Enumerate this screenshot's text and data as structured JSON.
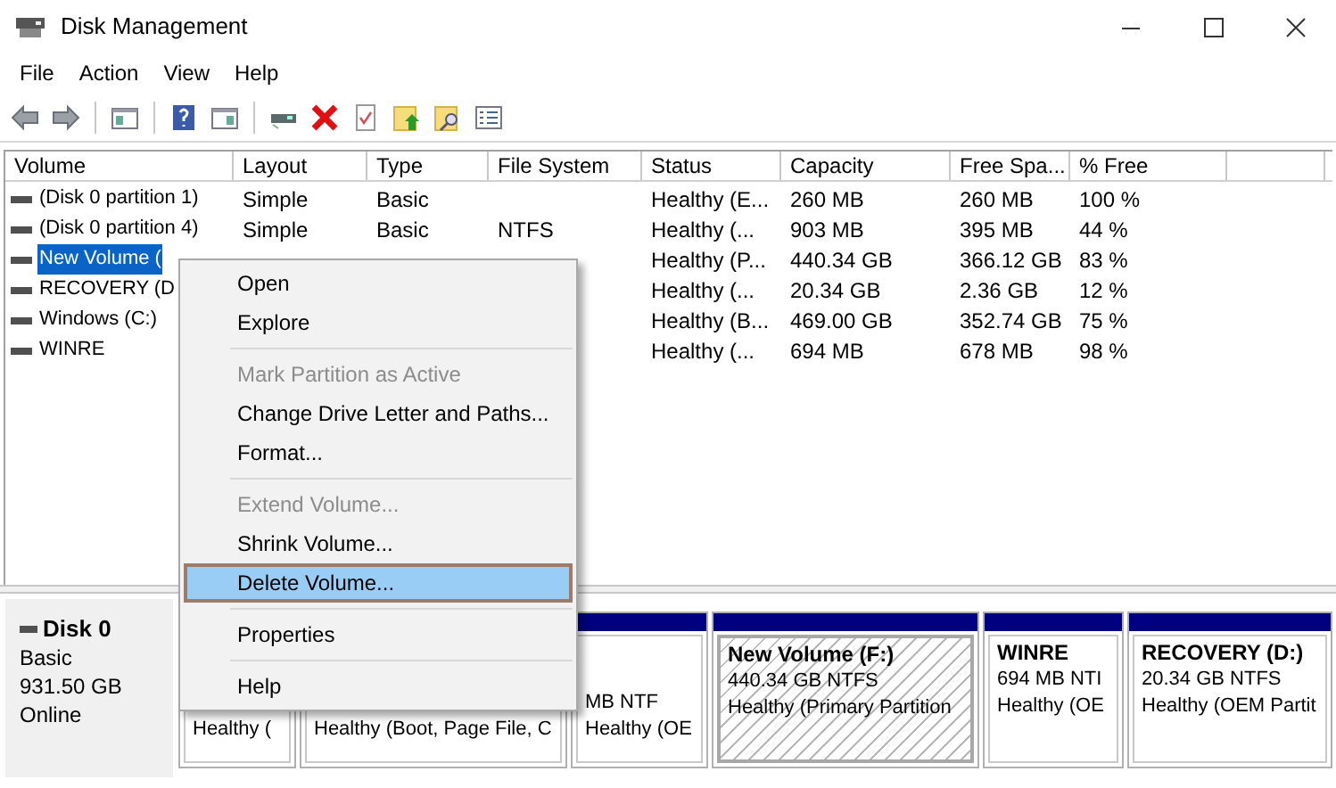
{
  "window": {
    "title": "Disk Management"
  },
  "menu": [
    "File",
    "Action",
    "View",
    "Help"
  ],
  "toolbar": [
    {
      "kind": "back"
    },
    {
      "kind": "forward"
    },
    {
      "kind": "sep"
    },
    {
      "kind": "tree"
    },
    {
      "kind": "sep"
    },
    {
      "kind": "help"
    },
    {
      "kind": "pane"
    },
    {
      "kind": "sep"
    },
    {
      "kind": "connect"
    },
    {
      "kind": "delete"
    },
    {
      "kind": "check"
    },
    {
      "kind": "folder_up"
    },
    {
      "kind": "folder_search"
    },
    {
      "kind": "list"
    }
  ],
  "table": {
    "columns": [
      "Volume",
      "Layout",
      "Type",
      "File System",
      "Status",
      "Capacity",
      "Free Spa...",
      "% Free"
    ],
    "rows": [
      {
        "volume": "(Disk 0 partition 1)",
        "layout": "Simple",
        "type": "Basic",
        "status": "Healthy (E...",
        "capacity": "260 MB",
        "free_space": "260 MB",
        "percent_free": "100 %",
        "selected": false
      },
      {
        "volume": "(Disk 0 partition 4)",
        "layout": "Simple",
        "type": "Basic",
        "file_system": "NTFS",
        "status": "Healthy (...",
        "capacity": "903 MB",
        "free_space": "395 MB",
        "percent_free": "44 %",
        "selected": false
      },
      {
        "volume": "New Volume (",
        "status": "Healthy (P...",
        "capacity": "440.34 GB",
        "free_space": "366.12 GB",
        "percent_free": "83 %",
        "selected": true
      },
      {
        "volume": "RECOVERY (D",
        "status": "Healthy (...",
        "capacity": "20.34 GB",
        "free_space": "2.36 GB",
        "percent_free": "12 %",
        "selected": false
      },
      {
        "volume": "Windows (C:)",
        "status": "Healthy (B...",
        "capacity": "469.00 GB",
        "free_space": "352.74 GB",
        "percent_free": "75 %",
        "selected": false
      },
      {
        "volume": "WINRE",
        "status": "Healthy (...",
        "capacity": "694 MB",
        "free_space": "678 MB",
        "percent_free": "98 %",
        "selected": false
      }
    ]
  },
  "context_menu": [
    {
      "kind": "item",
      "label": "Open",
      "disabled": false,
      "selected": false
    },
    {
      "kind": "item",
      "label": "Explore",
      "disabled": false,
      "selected": false
    },
    {
      "kind": "separator"
    },
    {
      "kind": "item",
      "label": "Mark Partition as Active",
      "disabled": true,
      "selected": false
    },
    {
      "kind": "item",
      "label": "Change Drive Letter and Paths...",
      "disabled": false,
      "selected": false
    },
    {
      "kind": "item",
      "label": "Format...",
      "disabled": false,
      "selected": false
    },
    {
      "kind": "separator"
    },
    {
      "kind": "item",
      "label": "Extend Volume...",
      "disabled": true,
      "selected": false
    },
    {
      "kind": "item",
      "label": "Shrink Volume...",
      "disabled": false,
      "selected": false
    },
    {
      "kind": "item",
      "label": "Delete Volume...",
      "disabled": false,
      "selected": true
    },
    {
      "kind": "separator"
    },
    {
      "kind": "item",
      "label": "Properties",
      "disabled": false,
      "selected": false
    },
    {
      "kind": "separator"
    },
    {
      "kind": "item",
      "label": "Help",
      "disabled": false,
      "selected": false
    }
  ],
  "disk": {
    "name": "Disk 0",
    "type": "Basic",
    "size": "931.50 GB",
    "status": "Online"
  },
  "partitions": [
    {
      "lines": [
        "Healthy ("
      ],
      "selected": false
    },
    {
      "lines": [
        "Healthy (Boot, Page File, C"
      ],
      "selected": false
    },
    {
      "lines": [
        "MB NTF",
        "Healthy (OE"
      ],
      "selected": false
    },
    {
      "name": "New Volume  (F:)",
      "lines": [
        "440.34 GB NTFS",
        "Healthy (Primary Partition"
      ],
      "selected": true
    },
    {
      "name": "WINRE",
      "lines": [
        "694 MB NTI",
        "Healthy (OE"
      ],
      "selected": false
    },
    {
      "name": "RECOVERY  (D:)",
      "lines": [
        "20.34 GB NTFS",
        "Healthy (OEM Partit"
      ],
      "selected": false
    }
  ]
}
